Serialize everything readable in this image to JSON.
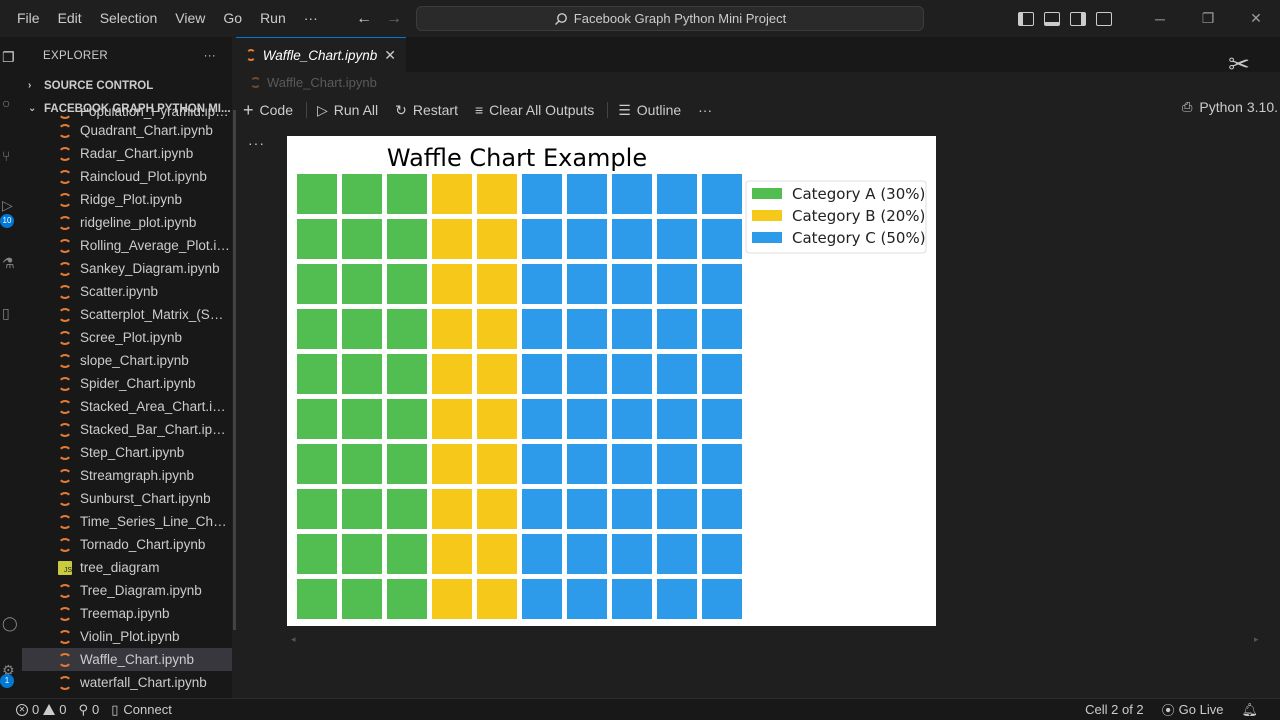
{
  "menu": [
    "File",
    "Edit",
    "Selection",
    "View",
    "Go",
    "Run",
    "···"
  ],
  "search": {
    "text": "Facebook Graph Python Mini Project"
  },
  "sidebar": {
    "title": "EXPLORER",
    "more": "···",
    "source_control": "SOURCE CONTROL",
    "project": "FACEBOOK GRAPH PYTHON MI...",
    "files": [
      {
        "name": "Population_Pyramid.ipy...",
        "icon": "notebook-icon",
        "partial": true
      },
      {
        "name": "Quadrant_Chart.ipynb",
        "icon": "notebook-icon"
      },
      {
        "name": "Radar_Chart.ipynb",
        "icon": "notebook-icon"
      },
      {
        "name": "Raincloud_Plot.ipynb",
        "icon": "notebook-icon"
      },
      {
        "name": "Ridge_Plot.ipynb",
        "icon": "notebook-icon"
      },
      {
        "name": "ridgeline_plot.ipynb",
        "icon": "notebook-icon"
      },
      {
        "name": "Rolling_Average_Plot.ip...",
        "icon": "notebook-icon"
      },
      {
        "name": "Sankey_Diagram.ipynb",
        "icon": "notebook-icon"
      },
      {
        "name": "Scatter.ipynb",
        "icon": "notebook-icon"
      },
      {
        "name": "Scatterplot_Matrix_(SPL...",
        "icon": "notebook-icon"
      },
      {
        "name": "Scree_Plot.ipynb",
        "icon": "notebook-icon"
      },
      {
        "name": "slope_Chart.ipynb",
        "icon": "notebook-icon"
      },
      {
        "name": "Spider_Chart.ipynb",
        "icon": "notebook-icon"
      },
      {
        "name": "Stacked_Area_Chart.ipy...",
        "icon": "notebook-icon"
      },
      {
        "name": "Stacked_Bar_Chart.ipynb",
        "icon": "notebook-icon"
      },
      {
        "name": "Step_Chart.ipynb",
        "icon": "notebook-icon"
      },
      {
        "name": "Streamgraph.ipynb",
        "icon": "notebook-icon"
      },
      {
        "name": "Sunburst_Chart.ipynb",
        "icon": "notebook-icon"
      },
      {
        "name": "Time_Series_Line_Chart...",
        "icon": "notebook-icon"
      },
      {
        "name": "Tornado_Chart.ipynb",
        "icon": "notebook-icon"
      },
      {
        "name": "tree_diagram",
        "icon": "js-file-icon"
      },
      {
        "name": "Tree_Diagram.ipynb",
        "icon": "notebook-icon"
      },
      {
        "name": "Treemap.ipynb",
        "icon": "notebook-icon"
      },
      {
        "name": "Violin_Plot.ipynb",
        "icon": "notebook-icon"
      },
      {
        "name": "Waffle_Chart.ipynb",
        "icon": "notebook-icon",
        "selected": true
      },
      {
        "name": "waterfall_Chart.ipynb",
        "icon": "notebook-icon"
      }
    ]
  },
  "activity": {
    "badge_scm": "10",
    "badge_account": "1"
  },
  "editor": {
    "tab_label": "Waffle_Chart.ipynb",
    "tab_close": "✕",
    "breadcrumb": "Waffle_Chart.ipynb",
    "toolbar": {
      "code": "Code",
      "run_all": "Run All",
      "restart": "Restart",
      "clear": "Clear All Outputs",
      "outline": "Outline",
      "more": "···"
    },
    "kernel": "Python 3.10.",
    "cell_more": "···"
  },
  "statusbar": {
    "errors": "0",
    "warnings": "0",
    "ports": "0",
    "connect": "Connect",
    "cell": "Cell 2 of 2",
    "go_live": "Go Live"
  },
  "colors": {
    "accent": "#0078d4",
    "cat_a": "#52be52",
    "cat_b": "#f6c819",
    "cat_c": "#2e9bea"
  },
  "chart_data": {
    "type": "waffle",
    "title": "Waffle Chart Example",
    "rows": 10,
    "cols": 10,
    "series": [
      {
        "name": "Category A (30%)",
        "value": 30,
        "color": "#52be52"
      },
      {
        "name": "Category B (20%)",
        "value": 20,
        "color": "#f6c819"
      },
      {
        "name": "Category C (50%)",
        "value": 50,
        "color": "#2e9bea"
      }
    ],
    "legend": "top-right"
  }
}
